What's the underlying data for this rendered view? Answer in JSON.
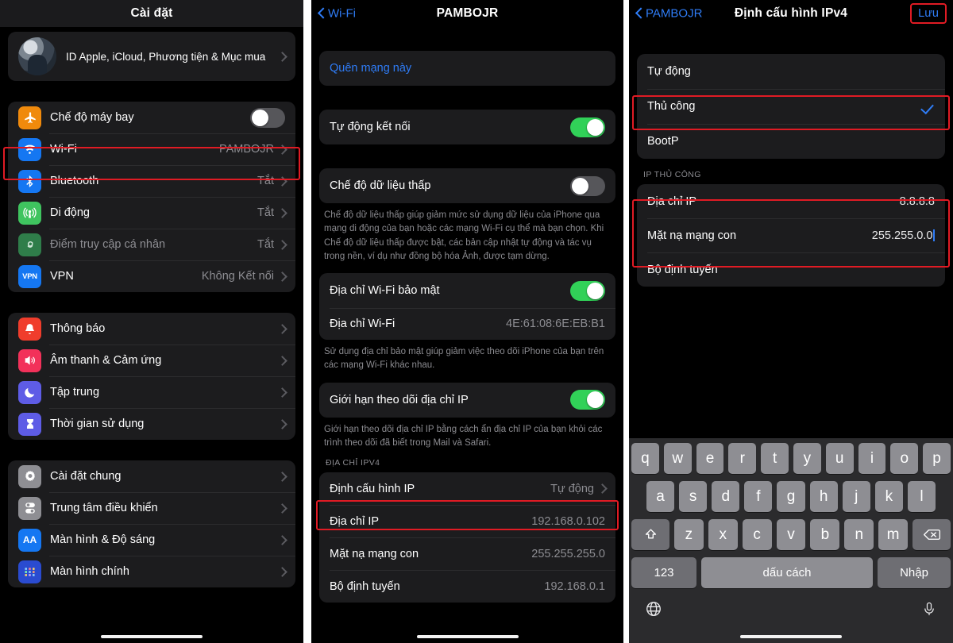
{
  "panel1": {
    "nav": {
      "title": "Cài đặt"
    },
    "profile": {
      "label": "ID Apple, iCloud, Phương tiện & Mục mua"
    },
    "group_connectivity": [
      {
        "label": "Chế độ máy bay",
        "icon": "airplane-icon",
        "color": "#f08a0c",
        "control": "switch-off"
      },
      {
        "label": "Wi-Fi",
        "icon": "wifi-icon",
        "color": "#1577f2",
        "value": "PAMBOJR",
        "control": "chevron",
        "highlighted": true
      },
      {
        "label": "Bluetooth",
        "icon": "bluetooth-icon",
        "color": "#1577f2",
        "value": "Tắt",
        "control": "chevron"
      },
      {
        "label": "Di động",
        "icon": "cellular-icon",
        "color": "#3fc45f",
        "value": "Tắt",
        "control": "chevron"
      },
      {
        "label": "Điểm truy cập cá nhân",
        "icon": "hotspot-icon",
        "color": "#2f7d4a",
        "value": "Tắt",
        "control": "chevron",
        "dim": true
      },
      {
        "label": "VPN",
        "icon": "vpn-icon",
        "color": "#1577f2",
        "value": "Không Kết nối",
        "control": "chevron"
      }
    ],
    "group_alerts": [
      {
        "label": "Thông báo",
        "icon": "bell-icon",
        "color": "#f03d2c",
        "control": "chevron"
      },
      {
        "label": "Âm thanh & Cảm ứng",
        "icon": "speaker-icon",
        "color": "#f2315a",
        "control": "chevron"
      },
      {
        "label": "Tập trung",
        "icon": "moon-icon",
        "color": "#5e5ce6",
        "control": "chevron"
      },
      {
        "label": "Thời gian sử dụng",
        "icon": "hourglass-icon",
        "color": "#5e5ce6",
        "control": "chevron"
      }
    ],
    "group_system": [
      {
        "label": "Cài đặt chung",
        "icon": "gear-icon",
        "color": "#8e8e93",
        "control": "chevron"
      },
      {
        "label": "Trung tâm điều khiển",
        "icon": "control-center-icon",
        "color": "#8e8e93",
        "control": "chevron"
      },
      {
        "label": "Màn hình & Độ sáng",
        "icon": "display-aa-icon",
        "color": "#1577f2",
        "control": "chevron"
      },
      {
        "label": "Màn hình chính",
        "icon": "home-screen-icon",
        "color": "#2a4bd0",
        "control": "chevron"
      }
    ]
  },
  "panel2": {
    "nav": {
      "back": "Wi-Fi",
      "title": "PAMBOJR"
    },
    "forget": {
      "label": "Quên mạng này"
    },
    "auto_join": {
      "label": "Tự động kết nối",
      "state": "on"
    },
    "low_data": {
      "label": "Chế độ dữ liệu thấp",
      "state": "off"
    },
    "low_data_note": "Chế độ dữ liệu thấp giúp giảm mức sử dụng dữ liệu của iPhone qua mạng di động của bạn hoặc các mạng Wi-Fi cụ thể mà bạn chọn. Khi Chế độ dữ liệu thấp được bật, các bản cập nhật tự động và tác vụ trong nền, ví dụ như đồng bộ hóa Ảnh, được tạm dừng.",
    "private_addr": {
      "label": "Địa chỉ Wi-Fi bảo mật",
      "state": "on"
    },
    "wifi_addr": {
      "label": "Địa chỉ Wi-Fi",
      "value": "4E:61:08:6E:EB:B1"
    },
    "private_note": "Sử dụng địa chỉ bảo mật giúp giảm việc theo dõi iPhone của bạn trên các mạng Wi-Fi khác nhau.",
    "limit_tracking": {
      "label": "Giới hạn theo dõi địa chỉ IP",
      "state": "on"
    },
    "limit_note": "Giới hạn theo dõi địa chỉ IP bằng cách ẩn địa chỉ IP của bạn khỏi các trình theo dõi đã biết trong Mail và Safari.",
    "ipv4_header": "ĐỊA CHỈ IPV4",
    "ipv4_rows": [
      {
        "label": "Định cấu hình IP",
        "value": "Tự động",
        "chevron": true,
        "highlighted": true
      },
      {
        "label": "Địa chỉ IP",
        "value": "192.168.0.102"
      },
      {
        "label": "Mặt nạ mạng con",
        "value": "255.255.255.0"
      },
      {
        "label": "Bộ định tuyến",
        "value": "192.168.0.1"
      }
    ]
  },
  "panel3": {
    "nav": {
      "back": "PAMBOJR",
      "title": "Định cấu hình IPv4",
      "save": "Lưu"
    },
    "modes": [
      {
        "label": "Tự động",
        "selected": false
      },
      {
        "label": "Thủ công",
        "selected": true,
        "highlighted": true
      },
      {
        "label": "BootP",
        "selected": false
      }
    ],
    "manual_header": "IP THỦ CÔNG",
    "manual_rows": [
      {
        "label": "Địa chỉ IP",
        "value": "8.8.8.8",
        "caret": false
      },
      {
        "label": "Mặt nạ mạng con",
        "value": "255.255.0.0",
        "caret": true
      },
      {
        "label": "Bộ định tuyến",
        "value": ""
      }
    ],
    "keyboard": {
      "row1": [
        "q",
        "w",
        "e",
        "r",
        "t",
        "y",
        "u",
        "i",
        "o",
        "p"
      ],
      "row2": [
        "a",
        "s",
        "d",
        "f",
        "g",
        "h",
        "j",
        "k",
        "l"
      ],
      "row3": [
        "z",
        "x",
        "c",
        "v",
        "b",
        "n",
        "m"
      ],
      "shift": "shift-icon",
      "backspace": "backspace-icon",
      "numbers": "123",
      "space": "dấu cách",
      "enter": "Nhập",
      "globe": "globe-icon",
      "mic": "microphone-icon"
    }
  },
  "colors": {
    "highlight": "#e01b24",
    "accent_blue": "#2f7cf6",
    "switch_on": "#31d158"
  }
}
